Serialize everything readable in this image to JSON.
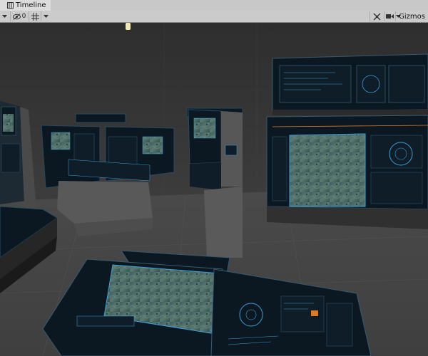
{
  "window": {
    "tab_title": "Timeline",
    "tab_icon": "timeline-icon"
  },
  "toolbar": {
    "hidden_count": "0",
    "gizmos_label": "Gizmos",
    "icons": [
      "dropdown-arrow-icon",
      "visibility-icon",
      "grid-icon",
      "dropdown-arrow-icon",
      "tools-icon",
      "camera-icon",
      "dropdown-arrow-icon"
    ]
  },
  "scene": {
    "description_colors": {
      "floor": "#4a4a4a",
      "wall": "#353535",
      "panel_dark": "#0b1822",
      "panel_frame": "#1a2c3a",
      "accent_blue": "#3aa0d8",
      "accent_orange": "#e07a20",
      "terrain": "#4f6a6a"
    }
  }
}
